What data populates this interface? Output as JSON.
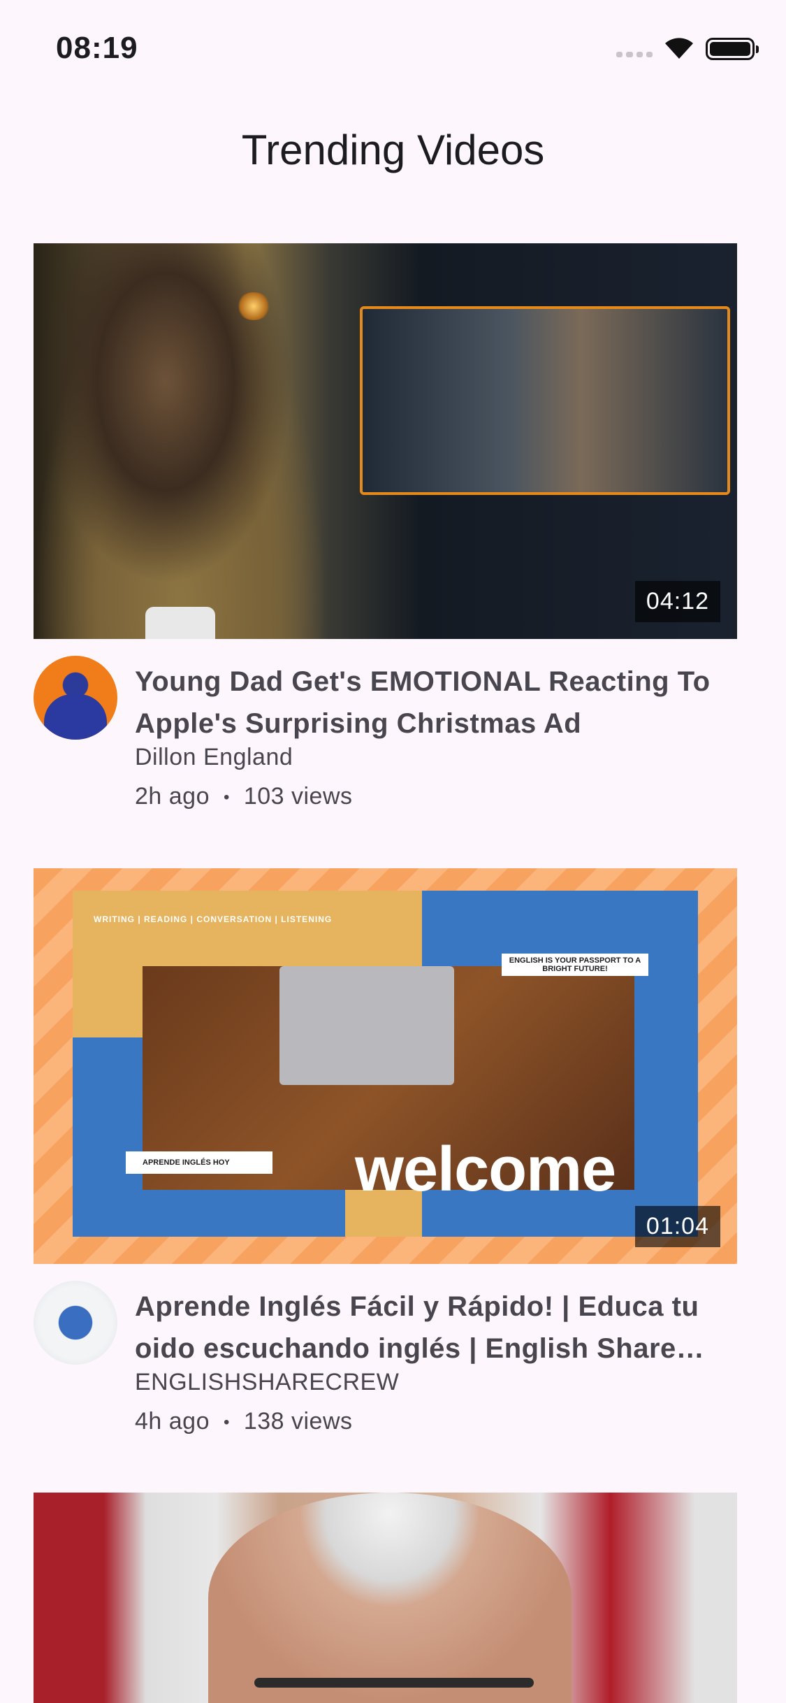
{
  "status_bar": {
    "time": "08:19"
  },
  "header": {
    "title": "Trending Videos"
  },
  "videos": [
    {
      "title": "Young Dad Get's EMOTIONAL Reacting To Apple's Surprising Christmas Ad",
      "channel": "Dillon England",
      "age": "2h ago",
      "views": "103 views",
      "duration": "04:12"
    },
    {
      "title": "Aprende Inglés Fácil y Rápido! | Educa tu oido escuchando inglés | English Share Crew",
      "channel": "ENGLISHSHARECREW",
      "age": "4h ago",
      "views": "138 views",
      "duration": "01:04",
      "thumbnail_text": {
        "skills": "WRITING | READING | CONVERSATION | LISTENING",
        "passport": "ENGLISH IS YOUR PASSPORT TO A BRIGHT FUTURE!",
        "label": "APRENDE INGLÉS HOY",
        "welcome": "welcome"
      }
    },
    {}
  ],
  "meta_separator": "•",
  "colors": {
    "background": "#fdf7fd",
    "text": "#49454f",
    "accent_orange": "#f7a25e",
    "accent_blue": "#3a77c2"
  }
}
